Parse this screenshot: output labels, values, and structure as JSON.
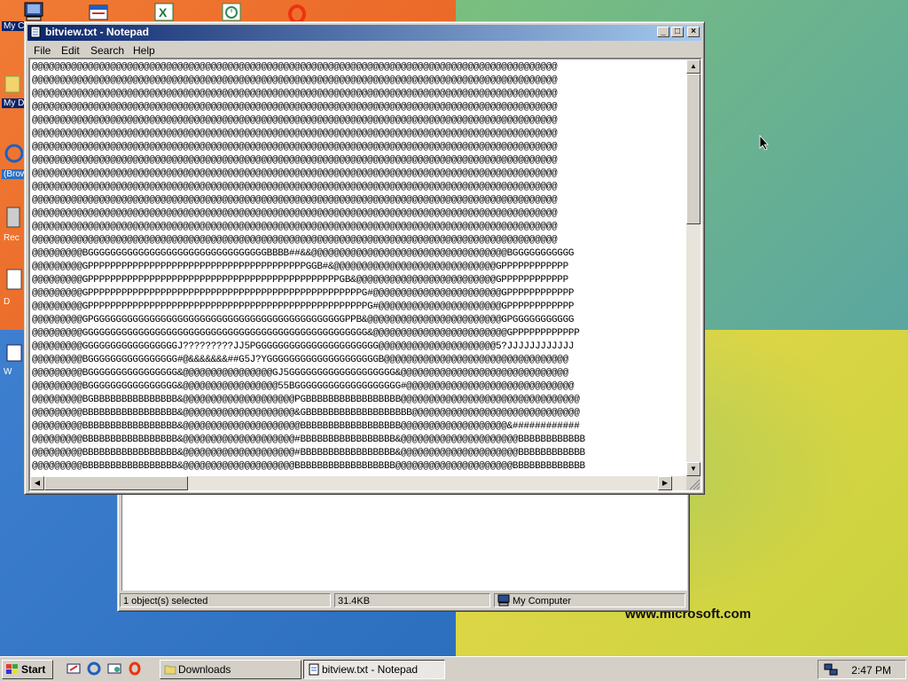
{
  "desktop": {
    "wallpaper_text": "www.microsoft.com",
    "icons": [
      {
        "label": "My C",
        "icon": "my-computer-icon"
      },
      {
        "label": "My D",
        "icon": "my-documents-icon"
      },
      {
        "label": "(Brow",
        "icon": "browser-icon"
      },
      {
        "label": "Rec",
        "icon": "recycle-bin-icon"
      },
      {
        "label": "D",
        "icon": "document-icon"
      },
      {
        "label": "W",
        "icon": "word-icon"
      }
    ]
  },
  "explorer_window": {
    "status": {
      "selection": "1 object(s) selected",
      "size": "31.4KB",
      "location": "My Computer"
    }
  },
  "notepad": {
    "title": "bitview.txt - Notepad",
    "menu": [
      "File",
      "Edit",
      "Search",
      "Help"
    ],
    "lines": [
      "@@@@@@@@@@@@@@@@@@@@@@@@@@@@@@@@@@@@@@@@@@@@@@@@@@@@@@@@@@@@@@@@@@@@@@@@@@@@@@@@@@@@@@@@@@@@@@",
      "@@@@@@@@@@@@@@@@@@@@@@@@@@@@@@@@@@@@@@@@@@@@@@@@@@@@@@@@@@@@@@@@@@@@@@@@@@@@@@@@@@@@@@@@@@@@@@",
      "@@@@@@@@@@@@@@@@@@@@@@@@@@@@@@@@@@@@@@@@@@@@@@@@@@@@@@@@@@@@@@@@@@@@@@@@@@@@@@@@@@@@@@@@@@@@@@",
      "@@@@@@@@@@@@@@@@@@@@@@@@@@@@@@@@@@@@@@@@@@@@@@@@@@@@@@@@@@@@@@@@@@@@@@@@@@@@@@@@@@@@@@@@@@@@@@",
      "@@@@@@@@@@@@@@@@@@@@@@@@@@@@@@@@@@@@@@@@@@@@@@@@@@@@@@@@@@@@@@@@@@@@@@@@@@@@@@@@@@@@@@@@@@@@@@",
      "@@@@@@@@@@@@@@@@@@@@@@@@@@@@@@@@@@@@@@@@@@@@@@@@@@@@@@@@@@@@@@@@@@@@@@@@@@@@@@@@@@@@@@@@@@@@@@",
      "@@@@@@@@@@@@@@@@@@@@@@@@@@@@@@@@@@@@@@@@@@@@@@@@@@@@@@@@@@@@@@@@@@@@@@@@@@@@@@@@@@@@@@@@@@@@@@",
      "@@@@@@@@@@@@@@@@@@@@@@@@@@@@@@@@@@@@@@@@@@@@@@@@@@@@@@@@@@@@@@@@@@@@@@@@@@@@@@@@@@@@@@@@@@@@@@",
      "@@@@@@@@@@@@@@@@@@@@@@@@@@@@@@@@@@@@@@@@@@@@@@@@@@@@@@@@@@@@@@@@@@@@@@@@@@@@@@@@@@@@@@@@@@@@@@",
      "@@@@@@@@@@@@@@@@@@@@@@@@@@@@@@@@@@@@@@@@@@@@@@@@@@@@@@@@@@@@@@@@@@@@@@@@@@@@@@@@@@@@@@@@@@@@@@",
      "@@@@@@@@@@@@@@@@@@@@@@@@@@@@@@@@@@@@@@@@@@@@@@@@@@@@@@@@@@@@@@@@@@@@@@@@@@@@@@@@@@@@@@@@@@@@@@",
      "@@@@@@@@@@@@@@@@@@@@@@@@@@@@@@@@@@@@@@@@@@@@@@@@@@@@@@@@@@@@@@@@@@@@@@@@@@@@@@@@@@@@@@@@@@@@@@",
      "@@@@@@@@@@@@@@@@@@@@@@@@@@@@@@@@@@@@@@@@@@@@@@@@@@@@@@@@@@@@@@@@@@@@@@@@@@@@@@@@@@@@@@@@@@@@@@",
      "@@@@@@@@@@@@@@@@@@@@@@@@@@@@@@@@@@@@@@@@@@@@@@@@@@@@@@@@@@@@@@@@@@@@@@@@@@@@@@@@@@@@@@@@@@@@@@",
      "@@@@@@@@@BGGGGGGGGGGGGGGGGGGGGGGGGGGGGGGGGBBBB##&&@@@@@@@@@@@@@@@@@@@@@@@@@@@@@@@@@@@BGGGGGGGGGGG",
      "@@@@@@@@@GPPPPPPPPPPPPPPPPPPPPPPPPPPPPPPPPPPPPPPPGGB#&@@@@@@@@@@@@@@@@@@@@@@@@@@@@@GPPPPPPPPPPPP",
      "@@@@@@@@@GPPPPPPPPPPPPPPPPPPPPPPPPPPPPPPPPPPPPPPPPPPPPPGB&@@@@@@@@@@@@@@@@@@@@@@@@@GPPPPPPPPPPPP",
      "@@@@@@@@@GPPPPPPPPPPPPPPPPPPPPPPPPPPPPPPPPPPPPPPPPPPPPPPPPPG#@@@@@@@@@@@@@@@@@@@@@@@GPPPPPPPPPPPP",
      "@@@@@@@@@GPPPPPPPPPPPPPPPPPPPPPPPPPPPPPPPPPPPPPPPPPPPPPPPPPPG#@@@@@@@@@@@@@@@@@@@@@@GPPPPPPPPPPPP",
      "@@@@@@@@@GPGGGGGGGGGGGGGGGGGGGGGGGGGGGGGGGGGGGGGGGGGGGGGPPB&@@@@@@@@@@@@@@@@@@@@@@@@GPGGGGGGGGGGG",
      "@@@@@@@@@GGGGGGGGGGGGGGGGGGGGGGGGGGGGGGGGGGGGGGGGGGGGGGGGGGG&@@@@@@@@@@@@@@@@@@@@@@@@GPPPPPPPPPPPP",
      "@@@@@@@@@GGGGGGGGGGGGGGGGGJ?????????JJ5PGGGGGGGGGGGGGGGGGGGGGG@@@@@@@@@@@@@@@@@@@@@5?JJJJJJJJJJJJ",
      "@@@@@@@@@BGGGGGGGGGGGGGGGG#@&&&&&&&##G5J?YGGGGGGGGGGGGGGGGGGGGB@@@@@@@@@@@@@@@@@@@@@@@@@@@@@@@@@",
      "@@@@@@@@@BGGGGGGGGGGGGGGGG&@@@@@@@@@@@@@@@@GJ5GGGGGGGGGGGGGGGGGGG&@@@@@@@@@@@@@@@@@@@@@@@@@@@@@@",
      "@@@@@@@@@BGGGGGGGGGGGGGGGG&@@@@@@@@@@@@@@@@@55BGGGGGGGGGGGGGGGGGGG#@@@@@@@@@@@@@@@@@@@@@@@@@@@@@@",
      "@@@@@@@@@BGBBBBBBBBBBBBBBB&@@@@@@@@@@@@@@@@@@@@PGBBBBBBBBBBBBBBBBB@@@@@@@@@@@@@@@@@@@@@@@@@@@@@@@@",
      "@@@@@@@@@BBBBBBBBBBBBBBBBB&@@@@@@@@@@@@@@@@@@@@&GBBBBBBBBBBBBBBBBBBB@@@@@@@@@@@@@@@@@@@@@@@@@@@@@@",
      "@@@@@@@@@BBBBBBBBBBBBBBBBB&@@@@@@@@@@@@@@@@@@@@@BBBBBBBBBBBBBBBBBB@@@@@@@@@@@@@@@@@@@&############",
      "@@@@@@@@@BBBBBBBBBBBBBBBBB&@@@@@@@@@@@@@@@@@@@@#BBBBBBBBBBBBBBBBB&@@@@@@@@@@@@@@@@@@@@@BBBBBBBBBBBB",
      "@@@@@@@@@BBBBBBBBBBBBBBBBB&@@@@@@@@@@@@@@@@@@@@#BBBBBBBBBBBBBBBBB&@@@@@@@@@@@@@@@@@@@@@BBBBBBBBBBBB",
      "@@@@@@@@@BBBBBBBBBBBBBBBBB&@@@@@@@@@@@@@@@@@@@@BBBBBBBBBBBBBBBBBB@@@@@@@@@@@@@@@@@@@@@BBBBBBBBBBBBB"
    ]
  },
  "taskbar": {
    "start_label": "Start",
    "buttons": [
      {
        "label": "Downloads",
        "icon": "folder-icon"
      },
      {
        "label": "bitview.txt - Notepad",
        "icon": "notepad-icon"
      }
    ],
    "clock": "2:47 PM"
  }
}
